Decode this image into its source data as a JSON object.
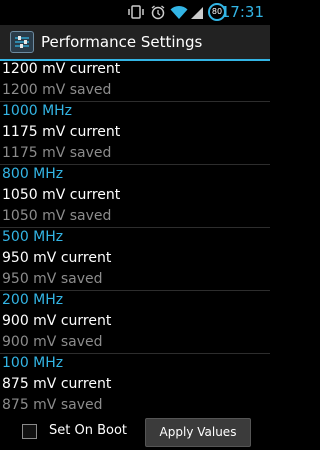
{
  "status_bar": {
    "time": "17:31",
    "battery_level": "80",
    "icons": [
      "vibrate-icon",
      "alarm-icon",
      "wifi-icon",
      "signal-icon",
      "battery-icon"
    ]
  },
  "app": {
    "title": "Performance Settings",
    "icon": "settings-sliders-icon"
  },
  "list": [
    {
      "type": "current",
      "text": "1200 mV current"
    },
    {
      "type": "saved",
      "text": "1200 mV saved"
    },
    {
      "type": "frequency",
      "text": "1000 MHz"
    },
    {
      "type": "current",
      "text": "1175 mV current"
    },
    {
      "type": "saved",
      "text": "1175 mV saved"
    },
    {
      "type": "frequency",
      "text": "800 MHz"
    },
    {
      "type": "current",
      "text": "1050 mV current"
    },
    {
      "type": "saved",
      "text": "1050 mV saved"
    },
    {
      "type": "frequency",
      "text": "500 MHz"
    },
    {
      "type": "current",
      "text": "950 mV current"
    },
    {
      "type": "saved",
      "text": "950 mV saved"
    },
    {
      "type": "frequency",
      "text": "200 MHz"
    },
    {
      "type": "current",
      "text": "900 mV current"
    },
    {
      "type": "saved",
      "text": "900 mV saved"
    },
    {
      "type": "frequency",
      "text": "100 MHz"
    },
    {
      "type": "current",
      "text": "875 mV current"
    },
    {
      "type": "saved",
      "text": "875 mV saved"
    }
  ],
  "bottom": {
    "checkbox_label": "Set On Boot",
    "checkbox_checked": false,
    "apply_label": "Apply Values"
  },
  "colors": {
    "accent": "#33b5e5",
    "saved_text": "#8c8c8c",
    "background": "#000000"
  }
}
